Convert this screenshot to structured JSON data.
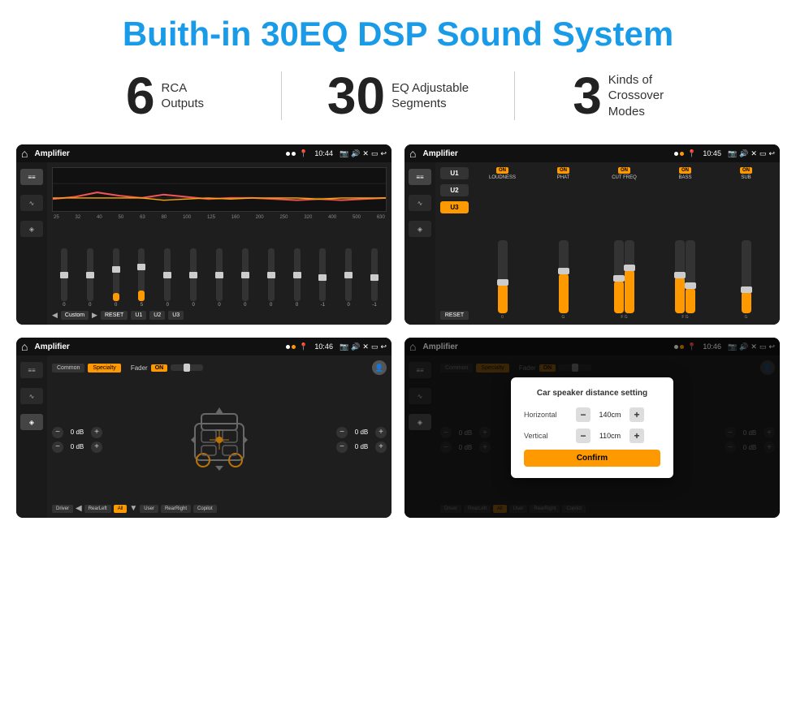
{
  "header": {
    "title": "Buith-in 30EQ DSP Sound System"
  },
  "stats": [
    {
      "number": "6",
      "label_line1": "RCA",
      "label_line2": "Outputs"
    },
    {
      "number": "30",
      "label_line1": "EQ Adjustable",
      "label_line2": "Segments"
    },
    {
      "number": "3",
      "label_line1": "Kinds of",
      "label_line2": "Crossover Modes"
    }
  ],
  "screens": {
    "screen1": {
      "title": "Amplifier",
      "time": "10:44",
      "eq_labels": [
        "25",
        "32",
        "40",
        "50",
        "63",
        "80",
        "100",
        "125",
        "160",
        "200",
        "250",
        "320",
        "400",
        "500",
        "630"
      ],
      "eq_values": [
        "0",
        "0",
        "0",
        "5",
        "0",
        "0",
        "0",
        "0",
        "0",
        "0",
        "0",
        "-1",
        "0",
        "-1"
      ],
      "bottom_btns": [
        "Custom",
        "RESET",
        "U1",
        "U2",
        "U3"
      ]
    },
    "screen2": {
      "title": "Amplifier",
      "time": "10:45",
      "presets": [
        "U1",
        "U2",
        "U3"
      ],
      "channels": [
        "LOUDNESS",
        "PHAT",
        "CUT FREQ",
        "BASS",
        "SUB"
      ],
      "reset_label": "RESET"
    },
    "screen3": {
      "title": "Amplifier",
      "time": "10:46",
      "tabs": [
        "Common",
        "Specialty"
      ],
      "fader_label": "Fader",
      "fader_on": "ON",
      "db_values": [
        "0 dB",
        "0 dB",
        "0 dB",
        "0 dB"
      ],
      "bottom_btns": [
        "Driver",
        "RearLeft",
        "All",
        "User",
        "RearRight",
        "Copilot"
      ]
    },
    "screen4": {
      "title": "Amplifier",
      "time": "10:46",
      "tabs": [
        "Common",
        "Specialty"
      ],
      "dialog": {
        "title": "Car speaker distance setting",
        "horizontal_label": "Horizontal",
        "horizontal_value": "140cm",
        "vertical_label": "Vertical",
        "vertical_value": "110cm",
        "confirm_label": "Confirm"
      },
      "db_values": [
        "0 dB",
        "0 dB"
      ],
      "bottom_btns": [
        "Driver",
        "RearLeft",
        "All",
        "User",
        "RearRight",
        "Copilot"
      ]
    }
  }
}
